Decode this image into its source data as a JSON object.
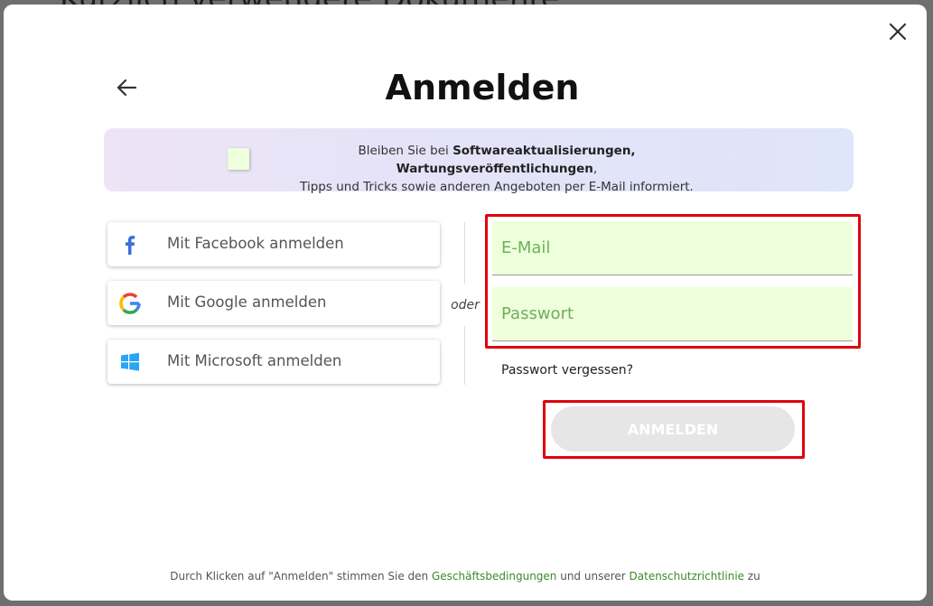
{
  "background": {
    "partial_text": "Kürzlich verwendete Dokumente"
  },
  "dialog": {
    "title": "Anmelden",
    "newsletter": {
      "text_prefix": "Bleiben Sie bei ",
      "text_bold": "Softwareaktualisierungen, Wartungsveröffentlichungen",
      "text_comma": ",",
      "text_line2": "Tipps und Tricks sowie anderen Angeboten per E-Mail informiert.",
      "checked": false
    },
    "social": [
      {
        "label": "Mit Facebook anmelden",
        "icon": "facebook-icon"
      },
      {
        "label": "Mit Google anmelden",
        "icon": "google-icon"
      },
      {
        "label": "Mit Microsoft anmelden",
        "icon": "windows-icon"
      }
    ],
    "separator": "oder",
    "email": {
      "placeholder": "E-Mail",
      "value": ""
    },
    "password": {
      "placeholder": "Passwort",
      "value": ""
    },
    "forgot_password": "Passwort vergessen?",
    "login_button": "ANMELDEN",
    "footer": {
      "before": "Durch Klicken auf \"Anmelden\" stimmen Sie den ",
      "terms_link": "Geschäftsbedingungen",
      "middle": " und unserer ",
      "privacy_link": "Datenschutzrichtlinie",
      "after": " zu"
    }
  },
  "colors": {
    "highlight_red": "#e0000f",
    "field_bg": "#eeffdc",
    "placeholder_green": "#6fae5c",
    "link_green": "#3b8a2a",
    "facebook_blue": "#3b6ed8",
    "button_disabled": "#e6e6e6"
  }
}
